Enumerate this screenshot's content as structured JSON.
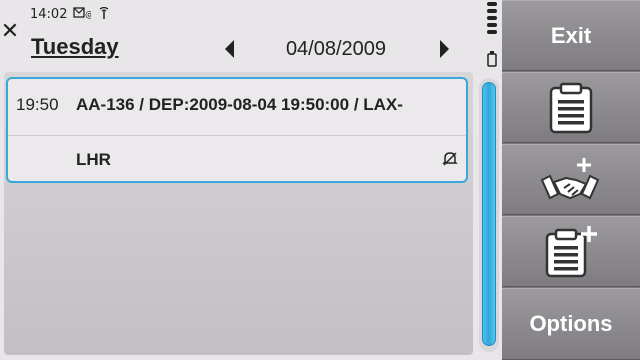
{
  "status": {
    "time": "14:02",
    "mail_icon": "envelope-icon",
    "signal_icon": "antenna-icon"
  },
  "header": {
    "day": "Tuesday",
    "date": "04/08/2009"
  },
  "event": {
    "time": "19:50",
    "title": "AA-136 / DEP:2009-08-04 19:50:00 / LAX-",
    "location": "LHR",
    "alarm_icon": "alarm-off-icon"
  },
  "toolbar": {
    "exit_label": "Exit",
    "new_entry_icon": "clipboard-icon",
    "new_meeting_icon": "handshake-plus-icon",
    "new_todo_icon": "clipboard-plus-icon",
    "options_label": "Options"
  },
  "colors": {
    "accent": "#3aa8d6",
    "toolbar": "#8a888b",
    "background": "#e9e6e9"
  }
}
